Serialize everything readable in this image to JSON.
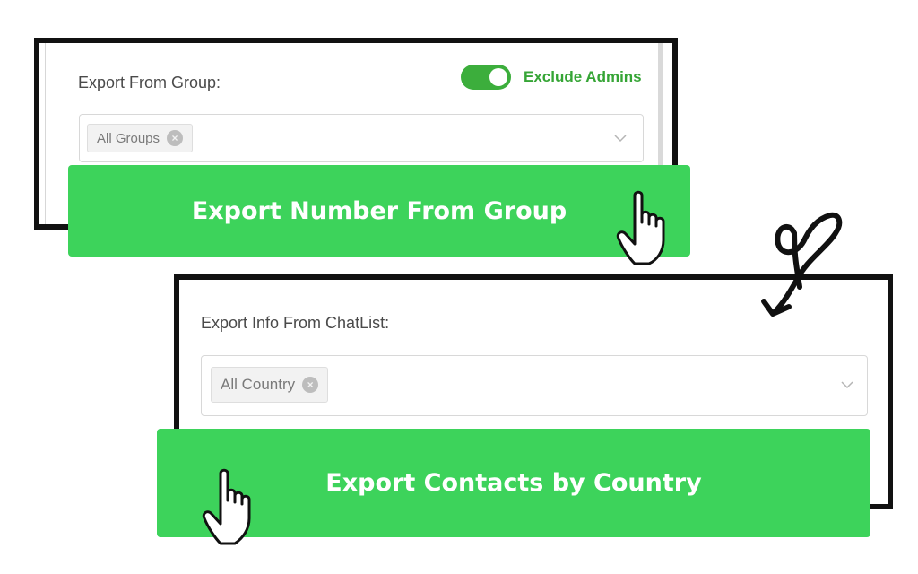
{
  "group_panel": {
    "label": "Export From Group:",
    "toggle": {
      "label": "Exclude Admins",
      "on": true
    },
    "select": {
      "selected_tag": "All Groups",
      "remove_symbol": "×"
    },
    "button_label": "Export Number From Group"
  },
  "chatlist_panel": {
    "label": "Export Info From ChatList:",
    "select": {
      "selected_tag": "All Country",
      "remove_symbol": "×"
    },
    "button_label": "Export Contacts by Country"
  },
  "icons": {
    "toggle": "toggle-switch-icon",
    "tag_remove": "close-circle-icon",
    "dropdown": "chevron-down-icon",
    "cursor": "hand-pointer-icon",
    "arrow": "curved-arrow-icon"
  },
  "colors": {
    "button": "#3dd35b",
    "toggle_on": "#3cae3c",
    "toggle_label": "#36a536",
    "border": "#111111"
  }
}
